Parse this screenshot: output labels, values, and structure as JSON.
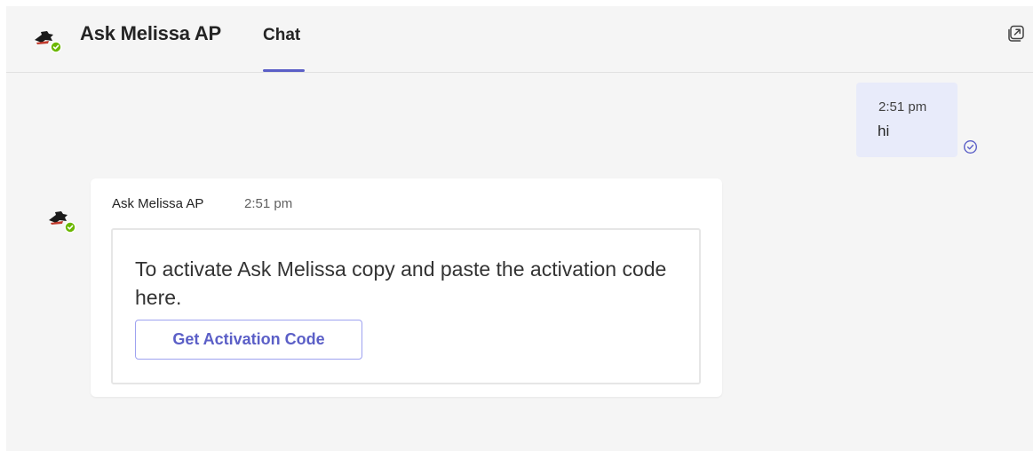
{
  "header": {
    "app_title": "Ask Melissa AP",
    "tab_label": "Chat",
    "accent_color": "#5b5fc7",
    "popout_icon": "popout-icon",
    "avatar_icon": "bot-avatar-icon",
    "presence_icon": "available-status-icon"
  },
  "messages": {
    "sent": {
      "time": "2:51 pm",
      "text": "hi",
      "status_icon": "read-receipt-icon"
    },
    "bot": {
      "sender": "Ask Melissa AP",
      "time": "2:51 pm",
      "card_text": "To activate Ask Melissa copy and paste the activation code here.",
      "button_label": "Get Activation Code"
    }
  }
}
